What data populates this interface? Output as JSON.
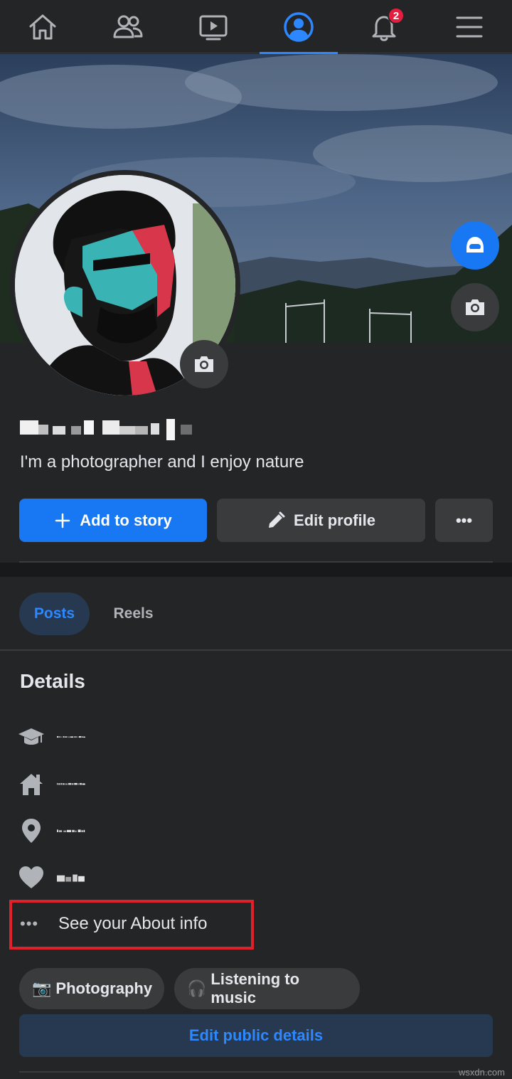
{
  "nav": {
    "items": [
      {
        "name": "home",
        "icon": "home-icon"
      },
      {
        "name": "friends",
        "icon": "friends-icon"
      },
      {
        "name": "watch",
        "icon": "video-icon"
      },
      {
        "name": "profile",
        "icon": "profile-icon",
        "active": true
      },
      {
        "name": "notifications",
        "icon": "bell-icon",
        "badge": "2"
      },
      {
        "name": "menu",
        "icon": "hamburger-icon"
      }
    ],
    "notification_count": "2"
  },
  "profile": {
    "bio": "I'm a photographer and I enjoy nature",
    "name_redacted": true
  },
  "actions": {
    "add_story": "Add to story",
    "edit_profile": "Edit profile",
    "more": "•••"
  },
  "tabs": {
    "posts": "Posts",
    "reels": "Reels"
  },
  "details": {
    "title": "Details",
    "rows": [
      {
        "icon": "education-icon"
      },
      {
        "icon": "home-icon"
      },
      {
        "icon": "location-pin-icon"
      },
      {
        "icon": "heart-icon"
      }
    ],
    "see_about": "See your About info",
    "see_about_dots": "•••"
  },
  "hobbies": {
    "items": [
      {
        "emoji": "📷",
        "label": "Photography"
      },
      {
        "emoji": "🎧",
        "label": "Listening to music"
      }
    ]
  },
  "edit_public": "Edit public details",
  "watermark": "wsxdn.com",
  "colors": {
    "accent": "#1877f2",
    "accent_text": "#2d88ff",
    "background": "#242526",
    "surface": "#3a3b3c",
    "highlight_box": "#e0202a"
  }
}
